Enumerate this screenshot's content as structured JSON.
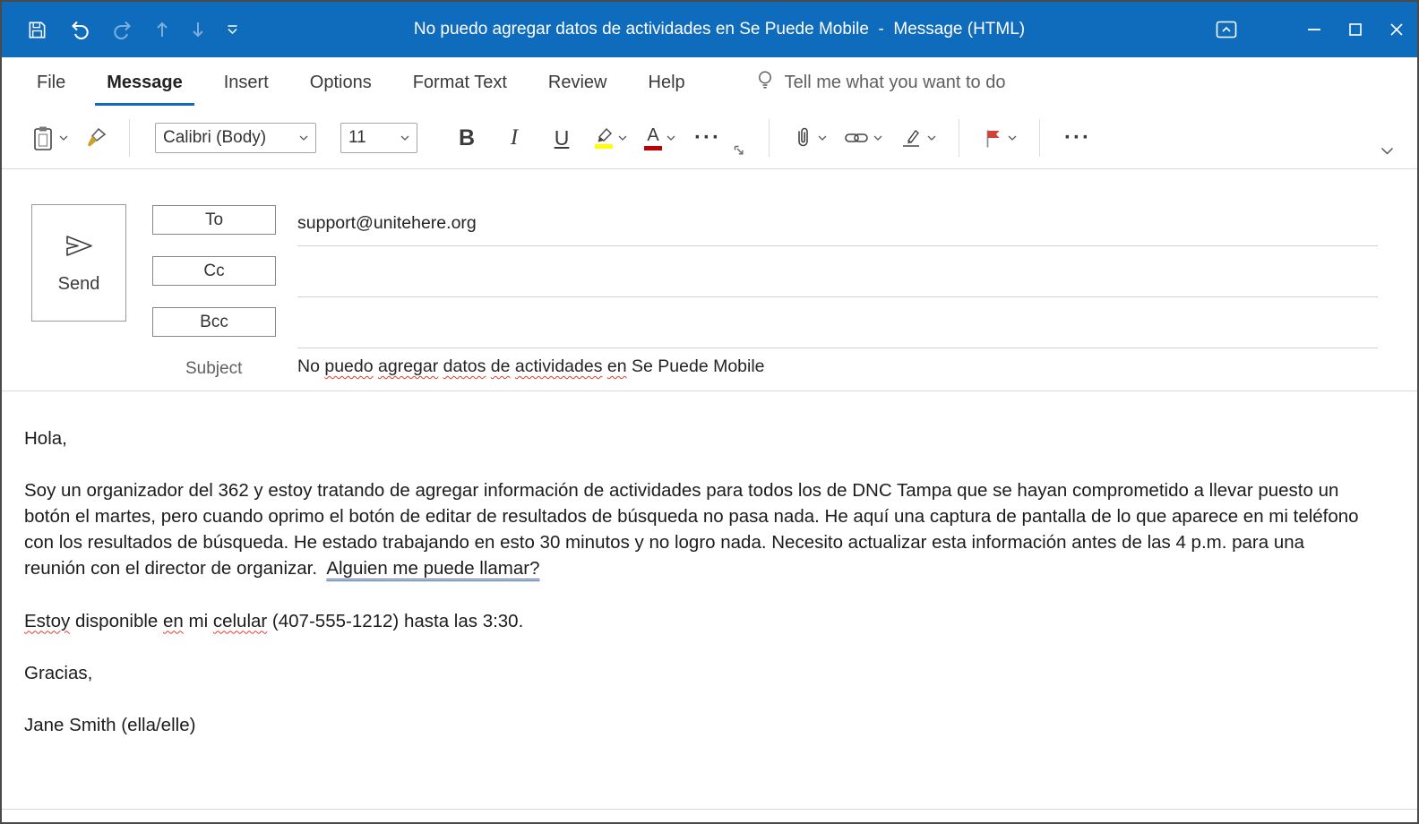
{
  "window": {
    "title": "No puedo agregar datos de actividades en Se Puede Mobile  -  Message (HTML)",
    "quick_access": [
      "save",
      "undo",
      "redo",
      "move-up",
      "move-down",
      "customize-quick-access-toolbar"
    ],
    "controls": [
      "ribbon-display-options",
      "minimize",
      "maximize",
      "close"
    ]
  },
  "ribbon": {
    "tabs": [
      {
        "label": "File",
        "active": false
      },
      {
        "label": "Message",
        "active": true
      },
      {
        "label": "Insert",
        "active": false
      },
      {
        "label": "Options",
        "active": false
      },
      {
        "label": "Format Text",
        "active": false
      },
      {
        "label": "Review",
        "active": false
      },
      {
        "label": "Help",
        "active": false
      }
    ],
    "tell_me": "Tell me what you want to do",
    "font_name": "Calibri (Body)",
    "font_size": "11",
    "toolbar_icons": [
      "paste",
      "format-painter",
      "bold",
      "italic",
      "underline",
      "text-highlight-color",
      "font-color",
      "more-commands",
      "basic-text-dialog-launcher",
      "attach-file",
      "insert-link",
      "signature",
      "follow-up-flag",
      "more-options",
      "collapse-ribbon"
    ]
  },
  "envelope": {
    "send_label": "Send",
    "to_label": "To",
    "cc_label": "Cc",
    "bcc_label": "Bcc",
    "subject_label": "Subject",
    "to_value": "support@unitehere.org",
    "cc_value": "",
    "bcc_value": "",
    "subject_segments": [
      {
        "text": "No "
      },
      {
        "text": "puedo",
        "spell": true
      },
      {
        "text": " "
      },
      {
        "text": "agregar",
        "spell": true
      },
      {
        "text": " "
      },
      {
        "text": "datos",
        "spell": true
      },
      {
        "text": " "
      },
      {
        "text": "de",
        "spell": true
      },
      {
        "text": " "
      },
      {
        "text": "actividades",
        "spell": true
      },
      {
        "text": " "
      },
      {
        "text": "en",
        "spell": true
      },
      {
        "text": " Se Puede Mobile"
      }
    ]
  },
  "body": {
    "paragraphs": [
      {
        "segments": [
          {
            "text": "Hola,"
          }
        ]
      },
      {
        "segments": [
          {
            "text": "Soy un organizador del 362 y estoy tratando de agregar información de actividades para todos los de DNC Tampa que se hayan comprometido a llevar puesto un botón el martes, pero cuando oprimo el botón de editar de resultados de búsqueda no pasa nada. He aquí una captura de pantalla de lo que aparece en mi teléfono con los resultados de búsqueda. He estado trabajando en esto 30 minutos y no logro nada. Necesito actualizar esta información antes de las 4 p.m. para una reunión con el director de organizar.  "
          },
          {
            "text": "Alguien me puede llamar?",
            "grammar": true
          }
        ]
      },
      {
        "segments": [
          {
            "text": "Estoy",
            "spell": true
          },
          {
            "text": " disponible "
          },
          {
            "text": "en",
            "spell": true
          },
          {
            "text": " mi "
          },
          {
            "text": "celular",
            "spell": true
          },
          {
            "text": " (407-555-1212) hasta las 3:30."
          }
        ]
      },
      {
        "segments": [
          {
            "text": "Gracias,"
          }
        ]
      },
      {
        "segments": [
          {
            "text": "Jane Smith (ella/elle)"
          }
        ]
      }
    ]
  },
  "colors": {
    "titlebar": "#0f6cbd",
    "tab_accent": "#0f6cbd",
    "flag_red": "#cf4436",
    "highlight_yellow": "#ffff00",
    "font_color_red": "#c00000",
    "spell_underline": "#e03b2e",
    "grammar_underline": "#3f63c7"
  }
}
